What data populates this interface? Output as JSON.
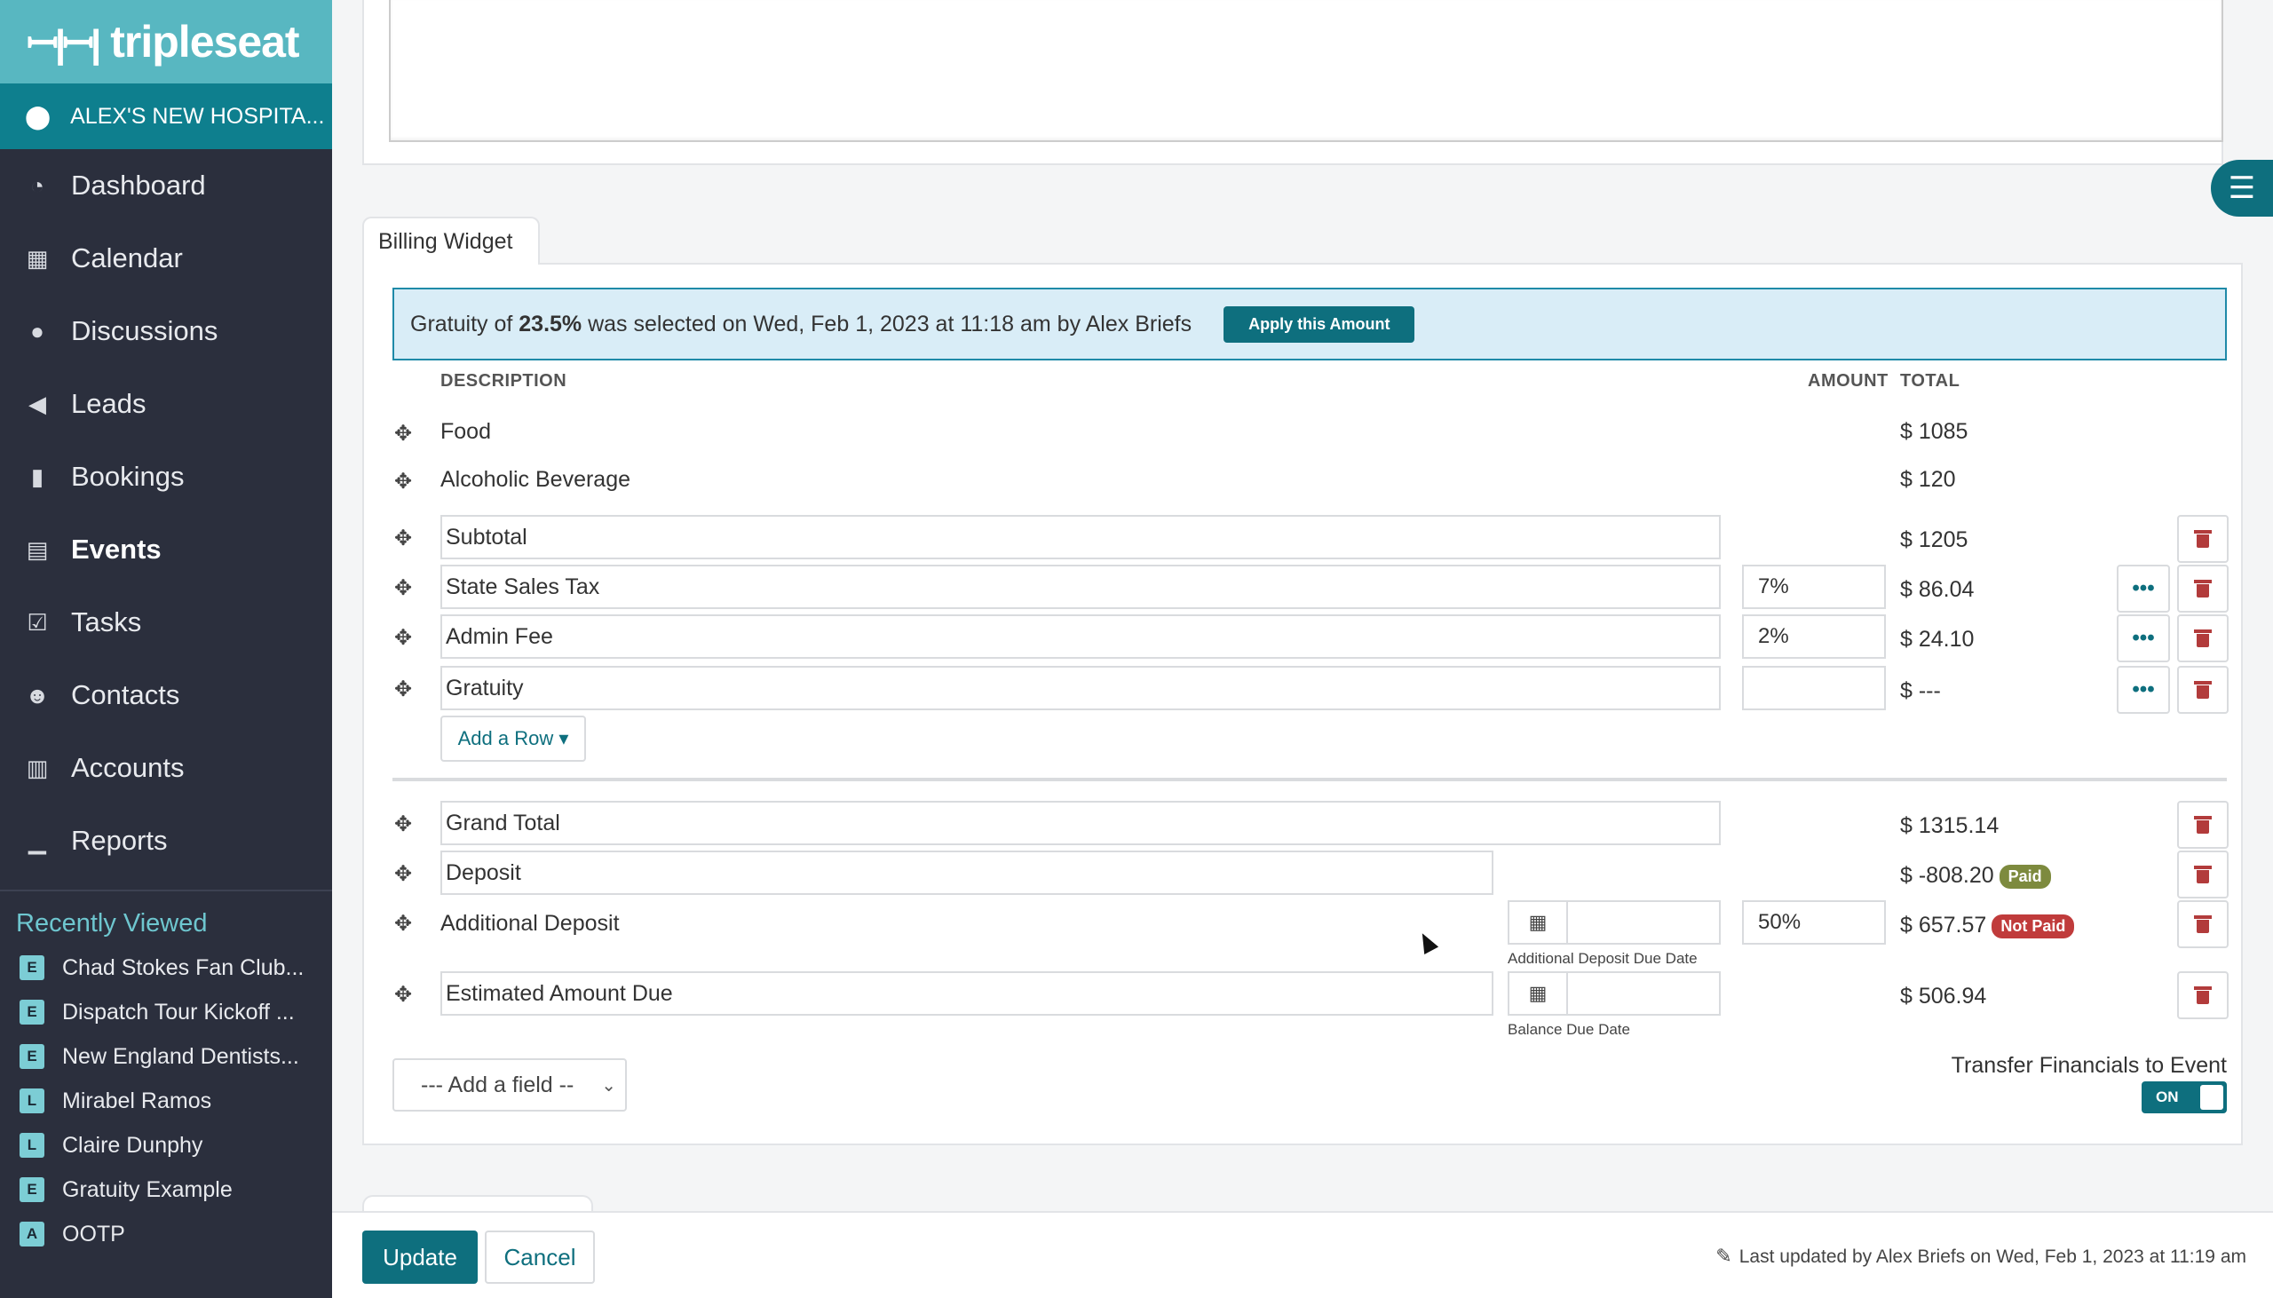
{
  "sidebar": {
    "logo": "tripleseat",
    "location": "ALEX'S NEW HOSPITA...",
    "nav": [
      {
        "label": "Dashboard",
        "icon": "dashboard-icon",
        "glyph": "◔"
      },
      {
        "label": "Calendar",
        "icon": "calendar-icon",
        "glyph": "▦"
      },
      {
        "label": "Discussions",
        "icon": "chat-icon",
        "glyph": "●"
      },
      {
        "label": "Leads",
        "icon": "megaphone-icon",
        "glyph": "◀"
      },
      {
        "label": "Bookings",
        "icon": "bookmark-icon",
        "glyph": "▮"
      },
      {
        "label": "Events",
        "icon": "list-icon",
        "glyph": "▤"
      },
      {
        "label": "Tasks",
        "icon": "checkbox-icon",
        "glyph": "☑"
      },
      {
        "label": "Contacts",
        "icon": "users-icon",
        "glyph": "☻"
      },
      {
        "label": "Accounts",
        "icon": "building-icon",
        "glyph": "▥"
      },
      {
        "label": "Reports",
        "icon": "bar-chart-icon",
        "glyph": "▁"
      }
    ],
    "recent_title": "Recently Viewed",
    "recent": [
      {
        "badge": "E",
        "label": "Chad Stokes Fan Club..."
      },
      {
        "badge": "E",
        "label": "Dispatch Tour Kickoff ..."
      },
      {
        "badge": "E",
        "label": "New England Dentists..."
      },
      {
        "badge": "L",
        "label": "Mirabel Ramos"
      },
      {
        "badge": "L",
        "label": "Claire Dunphy"
      },
      {
        "badge": "E",
        "label": "Gratuity Example"
      },
      {
        "badge": "A",
        "label": "OOTP"
      }
    ]
  },
  "billing": {
    "tab_label": "Billing Widget",
    "banner": {
      "prefix": "Gratuity of ",
      "percent": "23.5%",
      "suffix": " was selected on Wed, Feb 1, 2023 at 11:18 am by Alex Briefs",
      "button": "Apply this Amount"
    },
    "headers": {
      "description": "DESCRIPTION",
      "amount": "AMOUNT",
      "total": "TOTAL"
    },
    "rows": {
      "food": {
        "desc": "Food",
        "total": "$ 1085"
      },
      "alcohol": {
        "desc": "Alcoholic Beverage",
        "total": "$ 120"
      },
      "subtotal": {
        "desc": "Subtotal",
        "total": "$ 1205"
      },
      "tax": {
        "desc": "State Sales Tax",
        "amount": "7%",
        "total": "$ 86.04"
      },
      "admin": {
        "desc": "Admin Fee",
        "amount": "2%",
        "total": "$ 24.10"
      },
      "gratuity": {
        "desc": "Gratuity",
        "amount": "",
        "total": "$ ---"
      },
      "grand_total": {
        "desc": "Grand Total",
        "total": "$ 1315.14"
      },
      "deposit": {
        "desc": "Deposit",
        "total": "$ -808.20",
        "status": "Paid"
      },
      "additional_deposit": {
        "desc": "Additional Deposit",
        "amount": "50%",
        "total": "$ 657.57",
        "status": "Not Paid",
        "date_label": "Additional Deposit Due Date"
      },
      "estimated": {
        "desc": "Estimated Amount Due",
        "total": "$ 506.94",
        "date_label": "Balance Due Date"
      }
    },
    "add_row": "Add a Row ▾",
    "add_field": "--- Add a field --",
    "transfer_label": "Transfer Financials to Event",
    "toggle": "ON"
  },
  "footer": {
    "update": "Update",
    "cancel": "Cancel",
    "last_updated": "Last updated by Alex Briefs on Wed, Feb 1, 2023 at 11:19 am"
  }
}
